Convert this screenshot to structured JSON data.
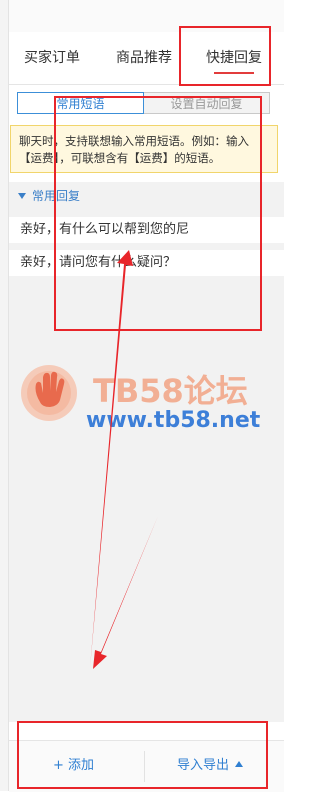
{
  "tabs": [
    {
      "label": "买家订单"
    },
    {
      "label": "商品推荐"
    },
    {
      "label": "快捷回复"
    }
  ],
  "segment": {
    "left": "常用短语",
    "right": "设置自动回复"
  },
  "hint": "聊天时，支持联想输入常用短语。例如：输入【运费】，可联想含有【运费】的短语。",
  "section": {
    "title": "常用回复"
  },
  "phrases": [
    {
      "text": "亲好，有什么可以帮到您的尼"
    },
    {
      "text": "亲好，请问您有什么疑问？"
    }
  ],
  "watermark": {
    "line1": "TB58论坛",
    "line2": "www.tb58.net"
  },
  "footer": {
    "add_label": "+ 添加",
    "io_label": "导入导出"
  },
  "colors": {
    "accent": "#2f7fd1",
    "active_tab_underline": "#e23c3c",
    "annotation_red": "#e8252a"
  }
}
